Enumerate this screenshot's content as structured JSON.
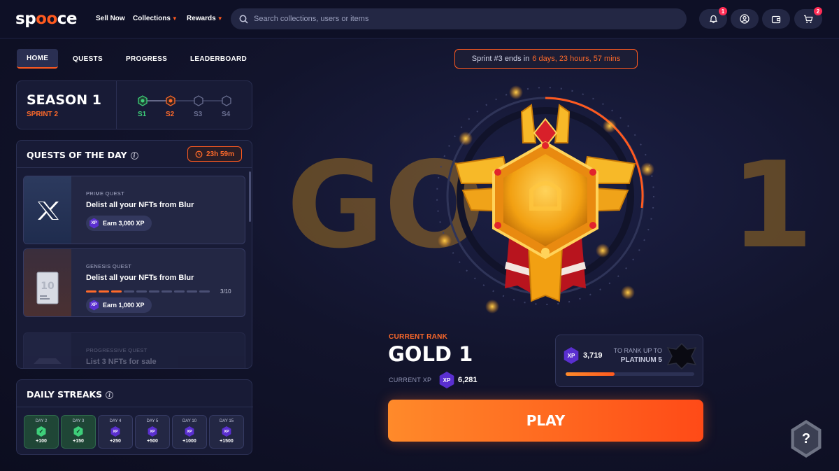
{
  "brand": {
    "logo_prefix": "sp",
    "logo_o": "oo",
    "logo_suffix": "ce"
  },
  "nav": {
    "sell_now": "Sell Now",
    "collections": "Collections",
    "rewards": "Rewards",
    "search_placeholder": "Search collections, users or items",
    "notifications_count": "1",
    "cart_count": "2"
  },
  "tabs": [
    {
      "label": "HOME",
      "active": true
    },
    {
      "label": "QUESTS"
    },
    {
      "label": "PROGRESS"
    },
    {
      "label": "LEADERBOARD"
    }
  ],
  "sprint_banner": {
    "prefix": "Sprint #3 ends in",
    "remaining": "6 days, 23 hours, 57 mins"
  },
  "season": {
    "title": "SEASON 1",
    "sprint": "SPRINT 2",
    "steps": [
      {
        "label": "S1",
        "state": "done"
      },
      {
        "label": "S2",
        "state": "current"
      },
      {
        "label": "S3",
        "state": "locked"
      },
      {
        "label": "S4",
        "state": "locked"
      }
    ]
  },
  "quests": {
    "title": "QUESTS OF THE DAY",
    "timer": "23h 59m",
    "items": [
      {
        "type": "PRIME QUEST",
        "name": "Delist all your NFTs from Blur",
        "reward": "Earn 3,000 XP",
        "thumb": "x-logo-icon"
      },
      {
        "type": "GENESIS QUEST",
        "name": "Delist all your NFTs from Blur",
        "reward": "Earn 1,000 XP",
        "progress": "3/10",
        "progress_value": 0.3,
        "thumb": "card-10-icon",
        "thumb_text": "10"
      },
      {
        "type": "PROGRESSIVE QUEST",
        "name": "List 3 NFTs for sale"
      }
    ]
  },
  "streaks": {
    "title": "DAILY STREAKS",
    "days": [
      {
        "label": "DAY 2",
        "value": "+100",
        "done": true
      },
      {
        "label": "DAY 3",
        "value": "+150",
        "done": true
      },
      {
        "label": "DAY 4",
        "value": "+250",
        "done": false
      },
      {
        "label": "DAY 5",
        "value": "+500",
        "done": false
      },
      {
        "label": "DAY 10",
        "value": "+1000",
        "done": false
      },
      {
        "label": "DAY 15",
        "value": "+1500",
        "done": false
      }
    ]
  },
  "rank": {
    "label": "CURRENT RANK",
    "name": "GOLD 1",
    "xp_label": "CURRENT XP",
    "xp_value": "6,281",
    "xp_icon_text": "XP",
    "bg_left": "GO",
    "bg_right": "1"
  },
  "rank_up": {
    "xp_needed": "3,719",
    "line1": "TO RANK UP TO",
    "line2": "PLATINUM 5",
    "progress": 0.38
  },
  "play_label": "PLAY",
  "help_label": "?",
  "colors": {
    "accent": "#ff5a1f",
    "xp_purple": "#5a2fd0",
    "success": "#3ecf7a",
    "gold": "#f2b019"
  }
}
